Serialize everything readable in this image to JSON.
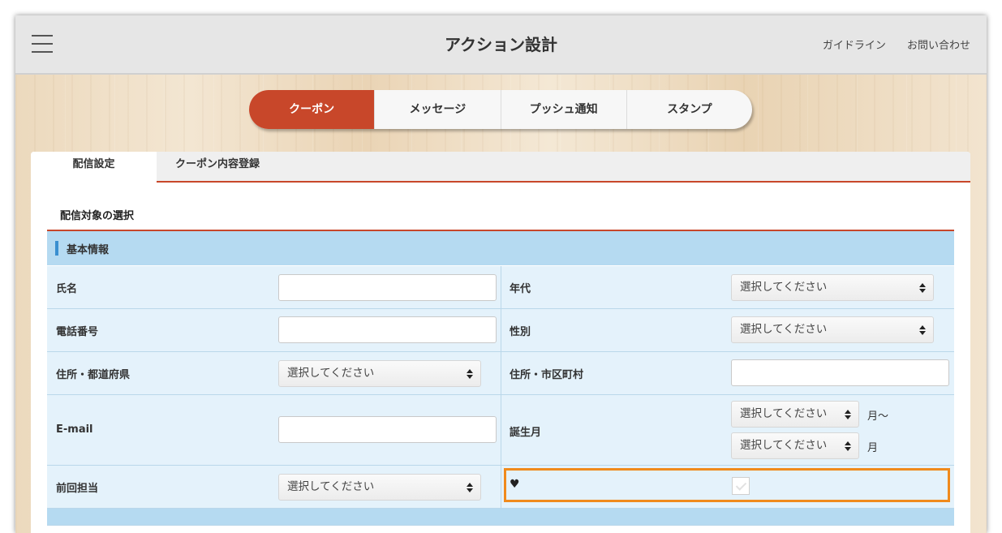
{
  "header": {
    "title": "アクション設計",
    "links": [
      "ガイドライン",
      "お問い合わせ"
    ]
  },
  "action_tabs": [
    {
      "label": "クーポン",
      "active": true
    },
    {
      "label": "メッセージ",
      "active": false
    },
    {
      "label": "プッシュ通知",
      "active": false
    },
    {
      "label": "スタンプ",
      "active": false
    }
  ],
  "sub_tabs": [
    {
      "label": "配信設定",
      "active": true
    },
    {
      "label": "クーポン内容登録",
      "active": false
    }
  ],
  "section_title": "配信対象の選択",
  "form": {
    "group_title": "基本情報",
    "select_placeholder": "選択してください",
    "name_label": "氏名",
    "age_label": "年代",
    "phone_label": "電話番号",
    "gender_label": "性別",
    "prefecture_label": "住所・都道府県",
    "city_label": "住所・市区町村",
    "email_label": "E-mail",
    "birth_month_label": "誕生月",
    "birth_month_from_unit": "月～",
    "birth_month_to_unit": "月",
    "last_staff_label": "前回担当",
    "favorite_label": "♥"
  },
  "colors": {
    "accent": "#c8472a",
    "form_header": "#b5daf1",
    "form_row": "#e4f2fb",
    "highlight": "#f08a1c"
  }
}
